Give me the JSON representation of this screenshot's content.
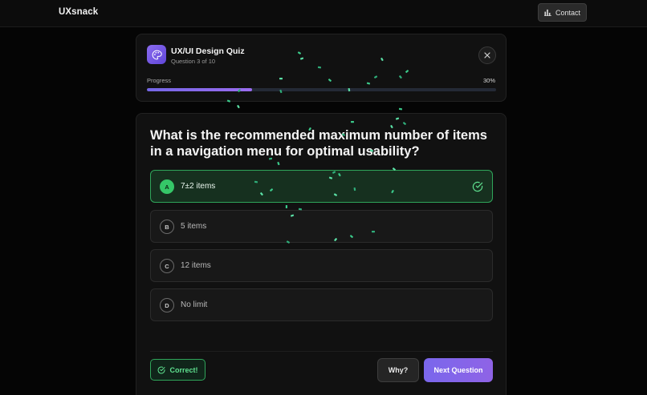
{
  "app": {
    "brand": "UXsnack",
    "contact_label": "Contact"
  },
  "quiz": {
    "title": "UX/UI Design Quiz",
    "subtitle": "Question 3 of 10",
    "progress_label": "Progress",
    "progress_text": "30%",
    "progress_value": 0.3
  },
  "question": {
    "text": "What is the recommended maximum number of items in a navigation menu for optimal usability?",
    "options": [
      {
        "letter": "A",
        "label": "7±2 items",
        "state": "correct"
      },
      {
        "letter": "B",
        "label": "5 items",
        "state": "default"
      },
      {
        "letter": "C",
        "label": "12 items",
        "state": "default"
      },
      {
        "letter": "D",
        "label": "No limit",
        "state": "default"
      }
    ]
  },
  "footer": {
    "feedback_label": "Correct!",
    "why_label": "Why?",
    "next_label": "Next Question"
  },
  "colors": {
    "accent": "#7a67ec",
    "success": "#35c768",
    "background": "#050505"
  }
}
